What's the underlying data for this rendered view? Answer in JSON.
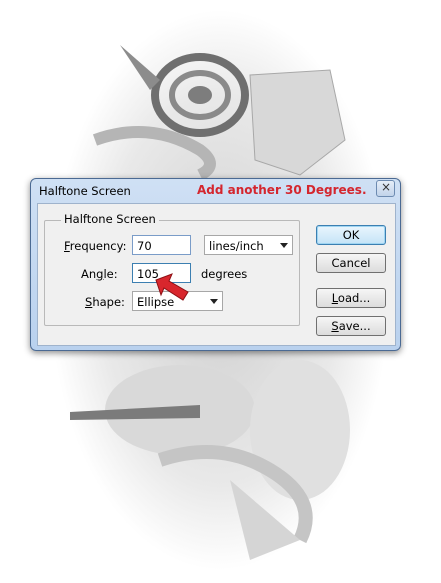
{
  "dialog": {
    "title": "Halftone Screen",
    "annotation": "Add another 30 Degrees.",
    "close_glyph": "×"
  },
  "group": {
    "legend": "Halftone Screen"
  },
  "fields": {
    "frequency": {
      "label_mnemonic": "F",
      "label_rest": "requency:",
      "value": "70",
      "unit": "lines/inch"
    },
    "angle": {
      "label_prefix": "An",
      "label_mnemonic": "g",
      "label_rest": "le:",
      "value": "105",
      "unit": "degrees"
    },
    "shape": {
      "label_mnemonic": "S",
      "label_rest": "hape:",
      "value": "Ellipse"
    }
  },
  "buttons": {
    "ok": "OK",
    "cancel": "Cancel",
    "load_mnemonic": "L",
    "load_rest": "oad...",
    "save_mnemonic": "S",
    "save_rest": "ave..."
  },
  "colors": {
    "annotation_red": "#d4262e",
    "arrow_red": "#d8262d"
  }
}
